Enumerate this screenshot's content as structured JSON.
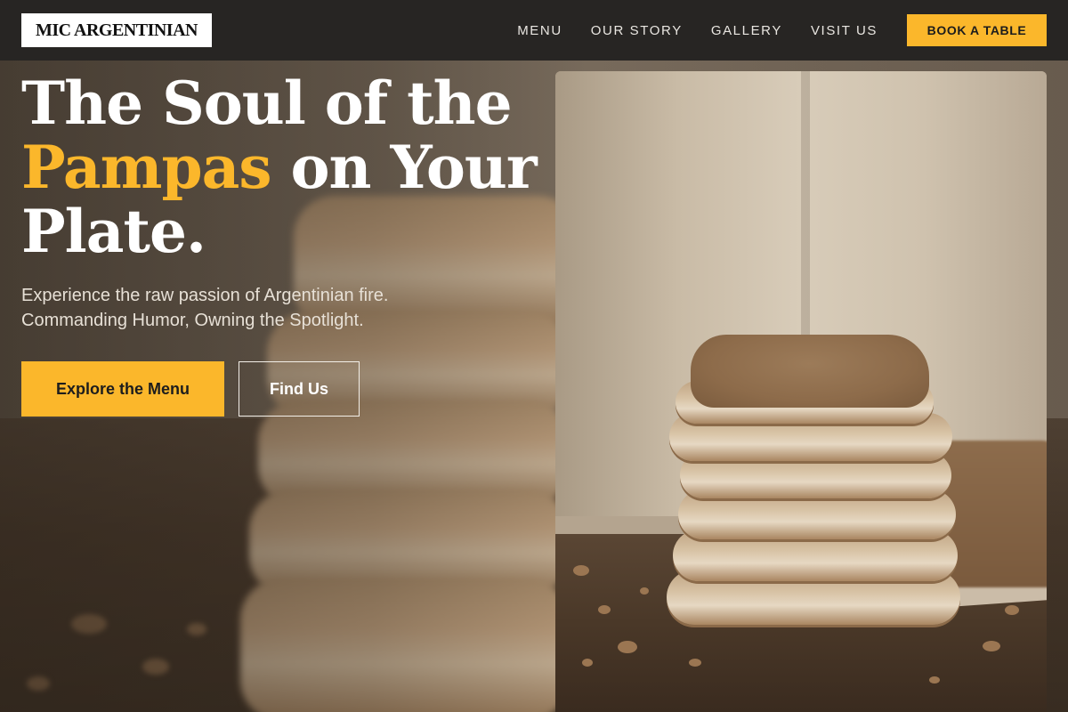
{
  "brand": {
    "logo_text": "MIC ARGENTINIAN"
  },
  "nav": {
    "items": [
      {
        "label": "MENU"
      },
      {
        "label": "OUR STORY"
      },
      {
        "label": "GALLERY"
      },
      {
        "label": "VISIT US"
      }
    ],
    "book_label": "BOOK A TABLE"
  },
  "hero": {
    "headline_line1": "The Soul of the",
    "headline_accent": "Pampas",
    "headline_line2_rest": " on Your",
    "headline_line3": "Plate.",
    "subtext_line1": "Experience the raw passion of Argentinian fire.",
    "subtext_line2": "Commanding Humor, Owning the Spotlight.",
    "cta_primary": "Explore the Menu",
    "cta_secondary": "Find Us"
  },
  "colors": {
    "accent": "#fbb72b",
    "navbar": "#272523",
    "headline": "#ffffff"
  }
}
